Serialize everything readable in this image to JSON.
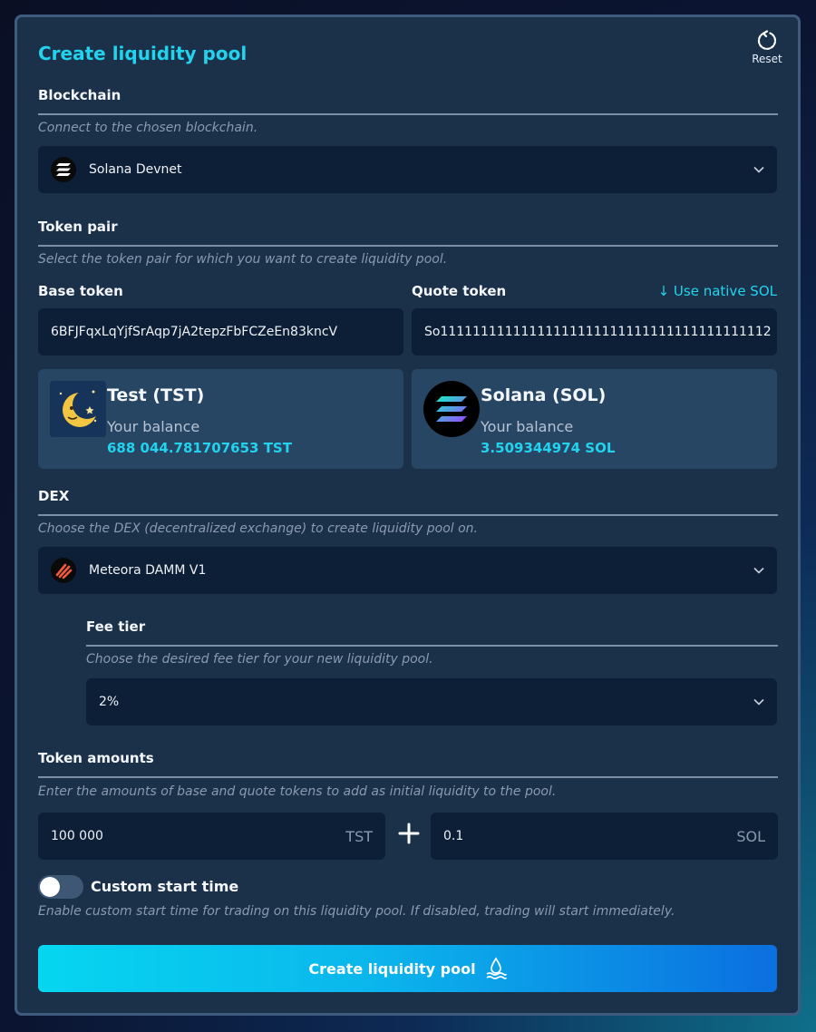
{
  "header": {
    "title": "Create liquidity pool",
    "reset_label": "Reset"
  },
  "blockchain": {
    "heading": "Blockchain",
    "hint": "Connect to the chosen blockchain.",
    "selected": "Solana Devnet"
  },
  "token_pair": {
    "heading": "Token pair",
    "hint": "Select the token pair for which you want to create liquidity pool.",
    "base_label": "Base token",
    "quote_label": "Quote token",
    "use_native_label": "↓ Use native SOL",
    "base_address": "6BFJFqxLqYjfSrAqp7jA2tepzFbFCZeEn83kncV",
    "quote_address": "So11111111111111111111111111111111111111112",
    "base_card": {
      "name": "Test (TST)",
      "balance_label": "Your balance",
      "balance_value": "688 044.781707653 TST"
    },
    "quote_card": {
      "name": "Solana (SOL)",
      "balance_label": "Your balance",
      "balance_value": "3.509344974 SOL"
    }
  },
  "dex": {
    "heading": "DEX",
    "hint": "Choose the DEX (decentralized exchange) to create liquidity pool on.",
    "selected": "Meteora DAMM V1"
  },
  "fee_tier": {
    "heading": "Fee tier",
    "hint": "Choose the desired fee tier for your new liquidity pool.",
    "selected": "2%"
  },
  "token_amounts": {
    "heading": "Token amounts",
    "hint": "Enter the amounts of base and quote tokens to add as initial liquidity to the pool.",
    "base_amount": "100 000",
    "base_unit": "TST",
    "quote_amount": "0.1",
    "quote_unit": "SOL"
  },
  "custom_start": {
    "label": "Custom start time",
    "hint": "Enable custom start time for trading on this liquidity pool. If disabled, trading will start immediately.",
    "enabled": false
  },
  "submit": {
    "label": "Create liquidity pool"
  },
  "colors": {
    "accent": "#22d3ee",
    "panel": "#1b3049",
    "field": "#0d1f36"
  }
}
